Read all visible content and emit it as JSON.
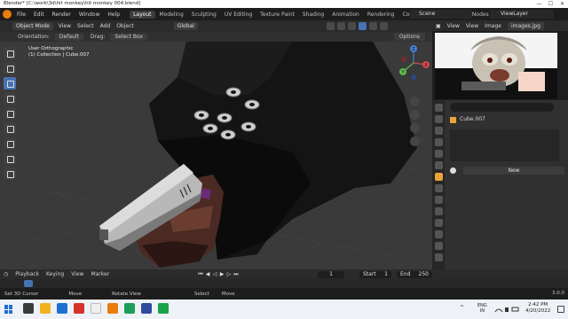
{
  "window": {
    "title": "Blender* [C:\\work\\3d\\hit monkey\\hit monkey 004.blend]",
    "minimize": "—",
    "maximize": "☐",
    "close": "✕"
  },
  "topbar": {
    "menus": [
      "File",
      "Edit",
      "Render",
      "Window",
      "Help"
    ],
    "workspaces": [
      "Layout",
      "Modeling",
      "Sculpting",
      "UV Editing",
      "Texture Paint",
      "Shading",
      "Animation",
      "Rendering",
      "Compositing",
      "Geometry Nodes"
    ],
    "active_workspace": "Layout",
    "scene": "Scene",
    "view_layer": "ViewLayer"
  },
  "viewport": {
    "mode": "Object Mode",
    "menus": [
      "View",
      "Select",
      "Add",
      "Object"
    ],
    "orientation_global": "Global",
    "tool_header": {
      "orientation_label": "Orientation:",
      "orientation_value": "Default",
      "drag_label": "Drag:",
      "drag_value": "Select Box",
      "options": "Options"
    },
    "info_line1": "User Orthographic",
    "info_line2": "(1) Collection | Cube.007",
    "gizmo_axes": {
      "x": "X",
      "y": "Y",
      "z": "Z"
    }
  },
  "image_editor": {
    "menus": [
      "View",
      "View",
      "Image"
    ],
    "file": "images.jpg"
  },
  "properties": {
    "object_name": "Cube.007",
    "new_button": "New"
  },
  "timeline": {
    "menus": [
      "Playback",
      "Keying",
      "View",
      "Marker"
    ],
    "current_frame": "1",
    "start_label": "Start",
    "start_value": "1",
    "end_label": "End",
    "end_value": "250"
  },
  "statusbar": {
    "item1": "Set 3D Cursor",
    "item2": "Move",
    "item3": "Rotate View",
    "item4": "Select",
    "item5": "Move",
    "version": "3.0.0"
  },
  "taskbar": {
    "lang1": "ENG",
    "lang2": "IN",
    "time": "2:42 PM",
    "date": "4/20/2022",
    "app_colors": [
      "#3b3b3b",
      "#f2b21f",
      "#1f6fd1",
      "#d6322b",
      "#f0f0f0",
      "#e87d0d",
      "#1e9e5a",
      "#2f4b9e",
      "#16a34a"
    ]
  }
}
